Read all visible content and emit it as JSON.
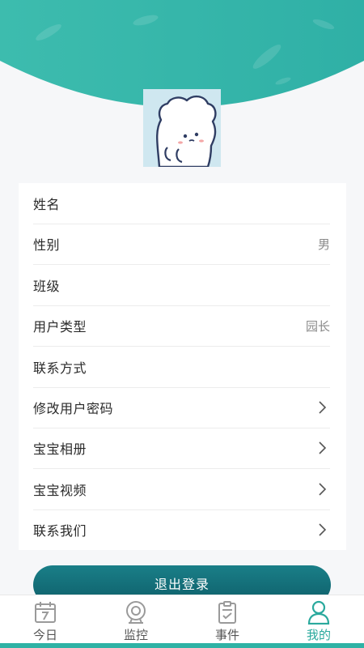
{
  "profile": {
    "rows": [
      {
        "label": "姓名",
        "value": ""
      },
      {
        "label": "性别",
        "value": "男"
      },
      {
        "label": "班级",
        "value": ""
      },
      {
        "label": "用户类型",
        "value": "园长"
      },
      {
        "label": "联系方式",
        "value": ""
      },
      {
        "label": "修改用户密码",
        "value": ""
      },
      {
        "label": "宝宝相册",
        "value": ""
      },
      {
        "label": "宝宝视频",
        "value": ""
      },
      {
        "label": "联系我们",
        "value": ""
      }
    ]
  },
  "logout_label": "退出登录",
  "tabbar": {
    "items": [
      {
        "label": "今日",
        "icon": "calendar-icon"
      },
      {
        "label": "监控",
        "icon": "camera-icon"
      },
      {
        "label": "事件",
        "icon": "clipboard-icon"
      },
      {
        "label": "我的",
        "icon": "person-icon"
      }
    ],
    "active": "我的"
  },
  "colors": {
    "accent": "#2aa99d",
    "header": "#37b5a8",
    "logout_button": "#0e5f6a"
  }
}
